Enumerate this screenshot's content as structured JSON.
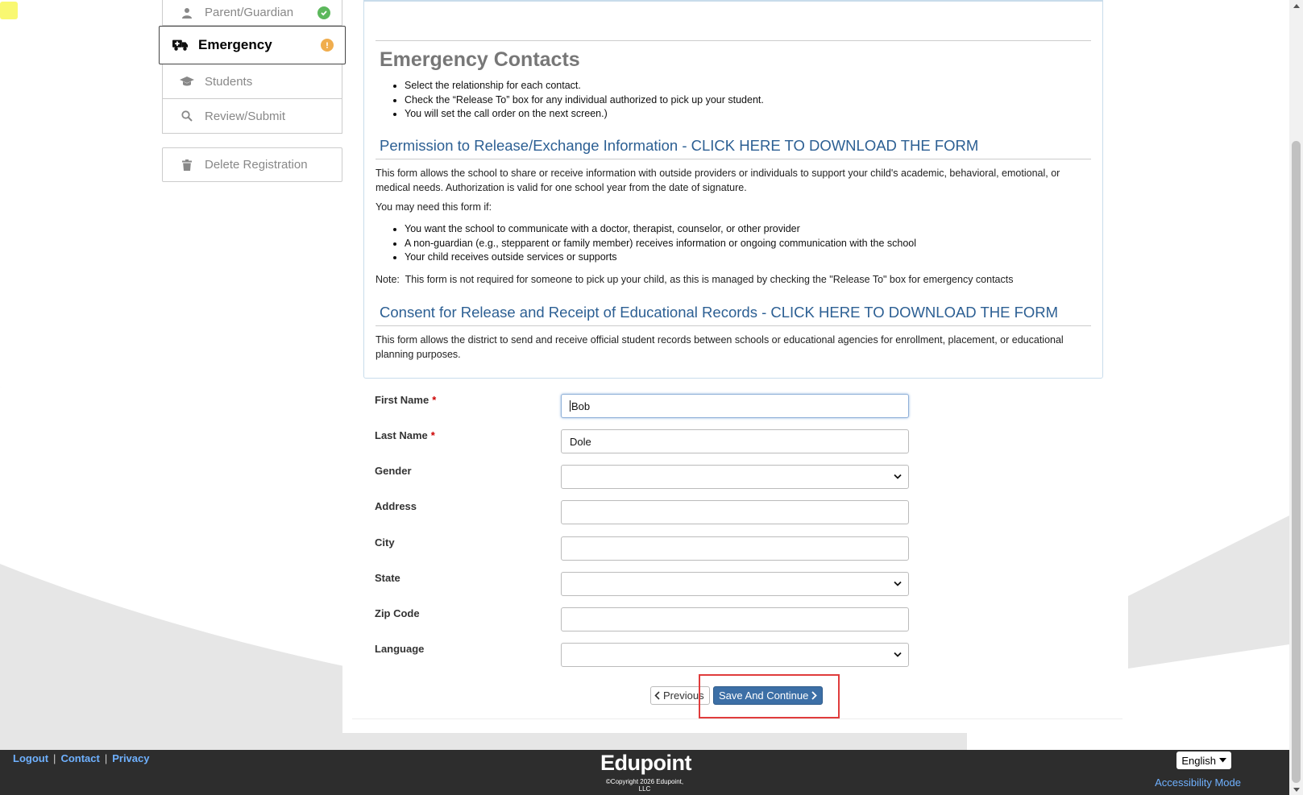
{
  "sidebar": {
    "items": [
      {
        "label": "Parent/Guardian",
        "icon": "user-icon",
        "status": "complete"
      },
      {
        "label": "Emergency",
        "icon": "ambulance-icon",
        "status": "warning"
      },
      {
        "label": "Students",
        "icon": "graduation-cap-icon"
      },
      {
        "label": "Review/Submit",
        "icon": "search-icon"
      }
    ],
    "delete_label": "Delete Registration"
  },
  "info": {
    "title": "Emergency Contacts",
    "instructions": [
      "Select the relationship for each contact.",
      "Check the “Release To” box for any individual authorized to pick up your student.",
      "You will set the call order on the next screen.)"
    ],
    "permission": {
      "heading_prefix": "Permission to Release/Exchange Information - ",
      "link": "CLICK HERE TO DOWNLOAD THE FORM",
      "description": "This form allows the school to share or receive information with outside providers or individuals to support your child's academic, behavioral, emotional, or medical needs. Authorization is valid for one school year from the date of signature.",
      "need_intro": "You may need this form if:",
      "reasons": [
        "You want the school to communicate with a doctor, therapist, counselor, or other provider",
        "A non-guardian (e.g., stepparent or family member) receives information or ongoing communication with the school",
        "Your child receives outside services or supports"
      ],
      "note_label": "Note:",
      "note_text": "This form is not required for someone to pick up your child, as this is managed by checking the \"Release To\" box for emergency contacts"
    },
    "consent": {
      "heading_prefix": "Consent for Release and Receipt of Educational Records - ",
      "link": "CLICK HERE TO DOWNLOAD THE FORM",
      "description": "This form allows the district to send and receive official student records between schools or educational agencies for enrollment, placement, or educational planning purposes."
    }
  },
  "form": {
    "required_mark": "*",
    "fields": [
      {
        "label": "First Name",
        "value": "Bob",
        "required": true,
        "type": "text"
      },
      {
        "label": "Last Name",
        "value": "Dole",
        "required": true,
        "type": "text"
      },
      {
        "label": "Gender",
        "value": "",
        "type": "select"
      },
      {
        "label": "Address",
        "value": "",
        "type": "text"
      },
      {
        "label": "City",
        "value": "",
        "type": "text"
      },
      {
        "label": "State",
        "value": "",
        "type": "select"
      },
      {
        "label": "Zip Code",
        "value": "",
        "type": "text"
      },
      {
        "label": "Language",
        "value": "",
        "type": "select"
      }
    ]
  },
  "buttons": {
    "previous": "Previous",
    "save_continue": "Save And Continue"
  },
  "footer": {
    "links": [
      "Logout",
      "Contact",
      "Privacy"
    ],
    "separator": "|",
    "brand": "Edupoint",
    "copyright": "©Copyright 2026 Edupoint, LLC",
    "language": "English",
    "accessibility": "Accessibility Mode"
  },
  "colors": {
    "accent": "#3c6fa6",
    "heading_blue": "#2c5f93",
    "highlight": "#e03c3c",
    "status_ok": "#5cb85c",
    "status_warn": "#f0ad4e"
  }
}
